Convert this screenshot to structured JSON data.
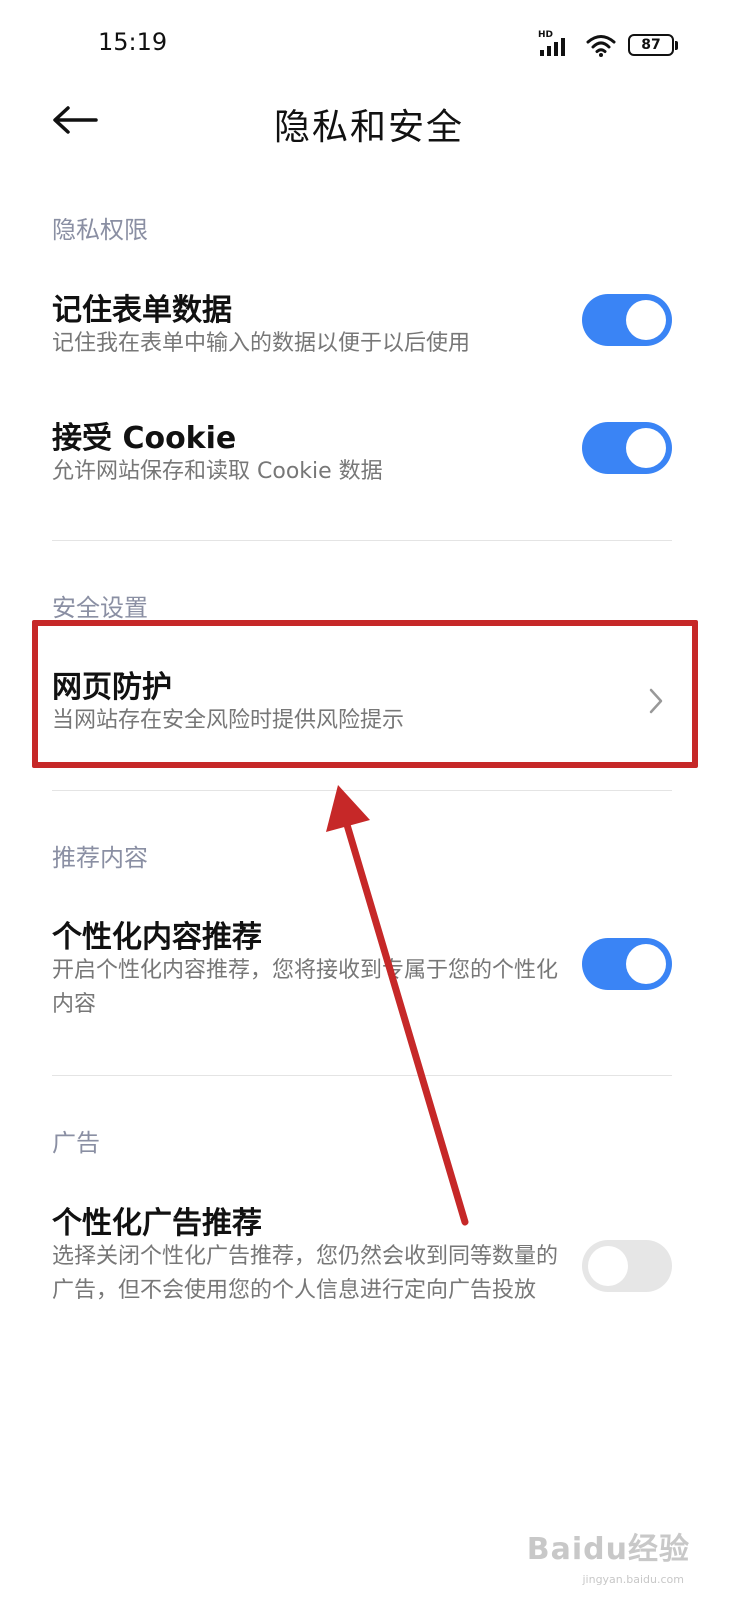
{
  "status_bar": {
    "time": "15:19",
    "network_label": "HD",
    "battery_level": "87",
    "icons": [
      "signal-icon",
      "wifi-icon",
      "battery-icon"
    ]
  },
  "header": {
    "back_icon": "arrow-left-icon",
    "title": "隐私和安全"
  },
  "sections": {
    "privacy": {
      "header": "隐私权限",
      "items": [
        {
          "title": "记住表单数据",
          "description": "记住我在表单中输入的数据以便于以后使用",
          "toggle": true
        },
        {
          "title": "接受 Cookie",
          "description": "允许网站保存和读取 Cookie 数据",
          "toggle": true
        }
      ]
    },
    "security": {
      "header": "安全设置",
      "items": [
        {
          "title": "网页防护",
          "description": "当网站存在安全风险时提供风险提示",
          "chevron_icon": "chevron-right-icon"
        }
      ]
    },
    "recommend": {
      "header": "推荐内容",
      "items": [
        {
          "title": "个性化内容推荐",
          "description": "开启个性化内容推荐，您将接收到专属于您的个性化内容",
          "toggle": true
        }
      ]
    },
    "ads": {
      "header": "广告",
      "items": [
        {
          "title": "个性化广告推荐",
          "description": "选择关闭个性化广告推荐，您仍然会收到同等数量的广告，但不会使用您的个人信息进行定向广告投放",
          "toggle": false
        }
      ]
    }
  },
  "annotation": {
    "highlight_color": "#c62828"
  },
  "watermark": {
    "brand": "Baidu经验",
    "domain": "jingyan.baidu.com"
  },
  "colors": {
    "accent": "#3a84f5",
    "toggle_off": "#e6e6e6",
    "section_header": "#8a8fa3"
  }
}
